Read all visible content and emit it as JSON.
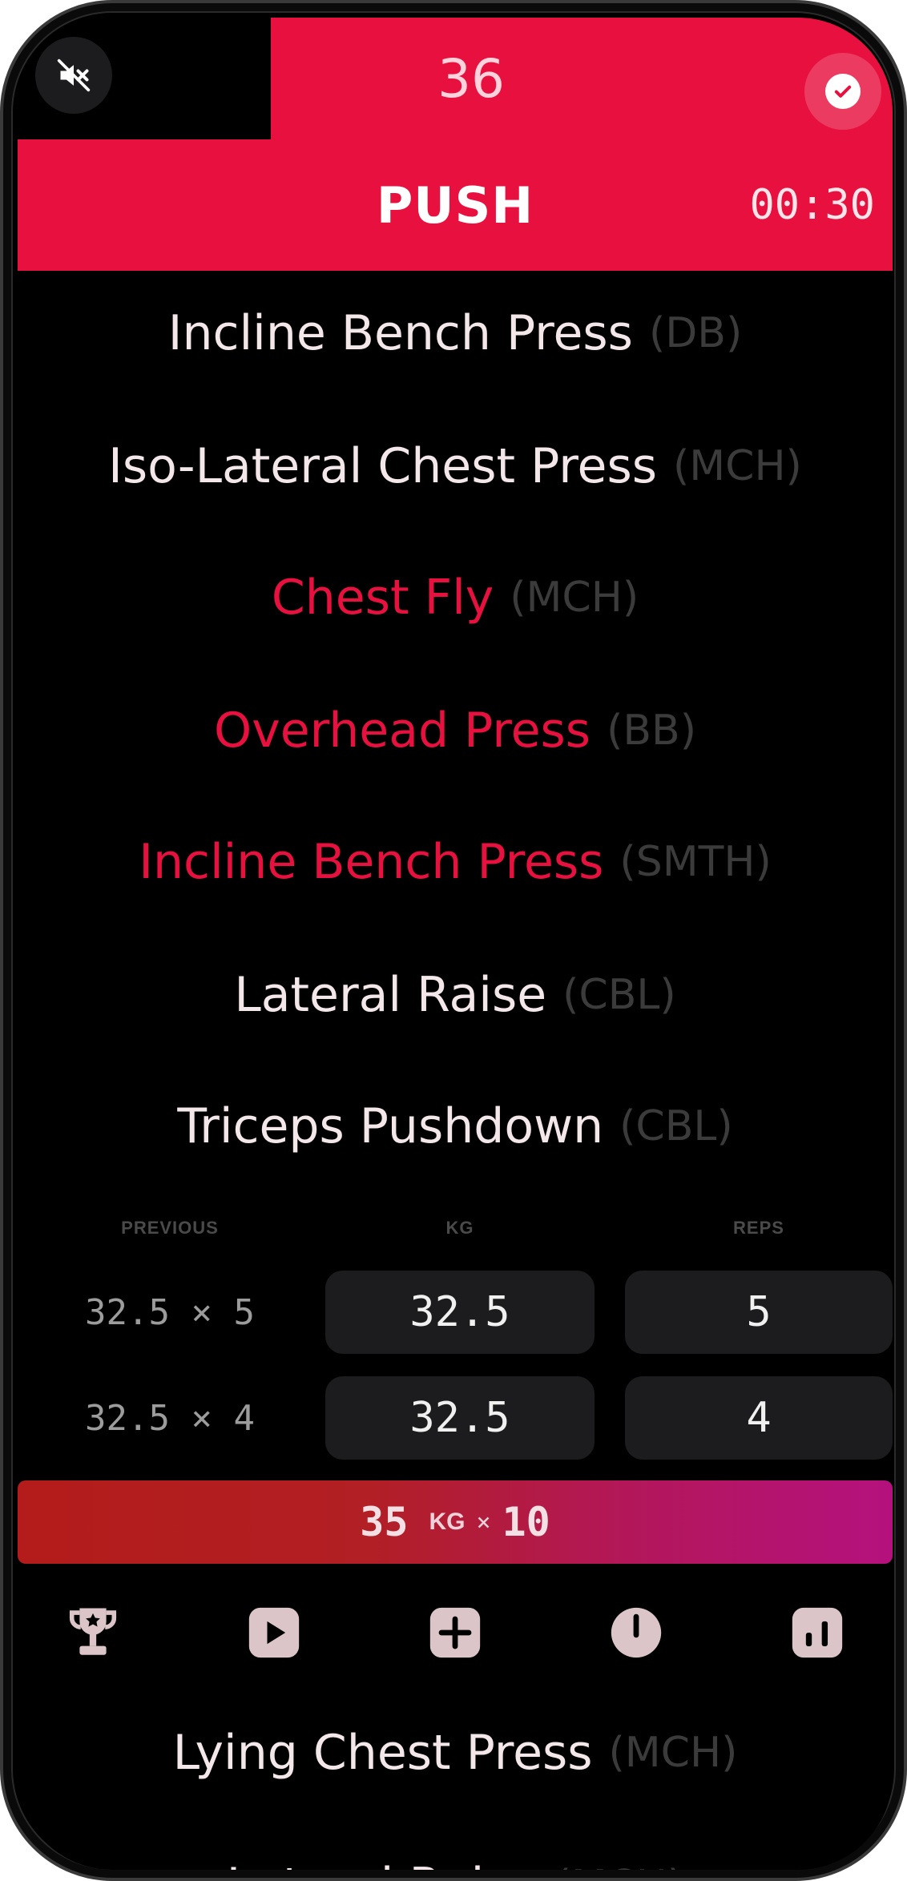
{
  "header": {
    "set_counter": "36",
    "workout_title": "PUSH",
    "rest_timer": "00:30"
  },
  "exercises_top": [
    {
      "name": "Incline Bench Press",
      "equipment": "(DB)"
    },
    {
      "name": "Iso-Lateral Chest Press",
      "equipment": "(MCH)"
    },
    {
      "name": "Chest Fly",
      "equipment": "(MCH)"
    },
    {
      "name": "Overhead Press",
      "equipment": "(BB)"
    },
    {
      "name": "Incline Bench Press",
      "equipment": "(SMTH)"
    },
    {
      "name": "Lateral Raise",
      "equipment": "(CBL)"
    },
    {
      "name": "Triceps Pushdown",
      "equipment": "(CBL)"
    }
  ],
  "sets_table": {
    "headers": {
      "previous": "PREVIOUS",
      "kg": "KG",
      "reps": "REPS"
    },
    "rows": [
      {
        "previous": "32.5 × 5",
        "kg": "32.5",
        "reps": "5"
      },
      {
        "previous": "32.5 × 4",
        "kg": "32.5",
        "reps": "4"
      }
    ]
  },
  "add_set": {
    "weight": "35",
    "unit": "KG",
    "times": "×",
    "reps": "10"
  },
  "toolbar": {
    "icons": [
      "trophy-icon",
      "play-icon",
      "plus-icon",
      "timer-icon",
      "chart-icon"
    ],
    "icon_color": "#dcc5c8"
  },
  "exercises_bottom": [
    {
      "name": "Lying Chest Press",
      "equipment": "(MCH)"
    },
    {
      "name": "Lateral Raise",
      "equipment": "(MCH)"
    }
  ],
  "colors": {
    "accent": "#e8103e",
    "background": "#000000"
  }
}
